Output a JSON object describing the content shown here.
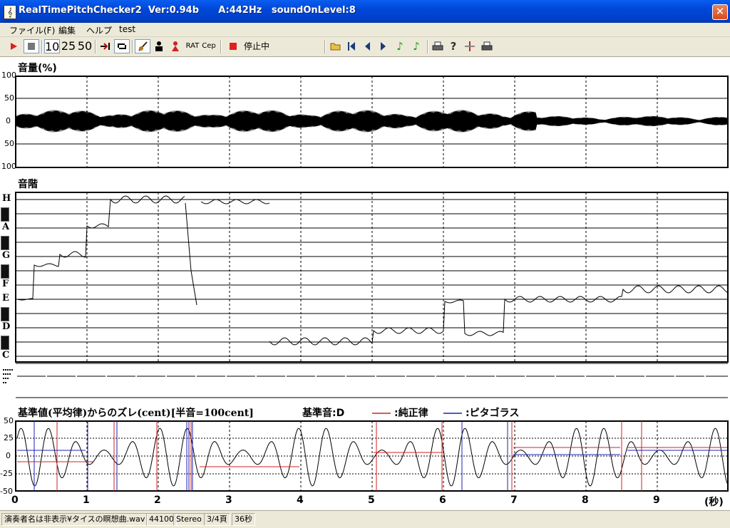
{
  "window": {
    "app_name": "RealTimePitchChecker2",
    "version": "Ver:0.94b",
    "pitch_a": "A:442Hz",
    "sound_on_level": "soundOnLevel:8",
    "icon": "tuning-fork-icon"
  },
  "menu": [
    "ファイル(F)",
    "編集",
    "ヘルプ",
    "test"
  ],
  "toolbar": {
    "speeds": [
      "10",
      "25",
      "50"
    ],
    "ratio_label": "RAT",
    "cep_label": "Cep",
    "stop_state": "停止中",
    "display_value": "＊＊＊",
    "colors": {
      "play": "#e02020",
      "accent_green": "#1a9a1a"
    }
  },
  "volume_panel": {
    "title": "音量(%)",
    "y_ticks": [
      "100",
      "50",
      "0",
      "50",
      "100"
    ]
  },
  "scale_panel": {
    "title": "音階",
    "notes": [
      "H",
      "A",
      "G",
      "F",
      "E",
      "D",
      "C"
    ]
  },
  "deviation_panel": {
    "title": "基準値(平均律)からのズレ(cent)[半音=100cent]",
    "base_note": "基準音:D",
    "legend": [
      {
        "label": ":純正律",
        "color": "#d42020"
      },
      {
        "label": ":ピタゴラス",
        "color": "#2020b0"
      }
    ],
    "y_ticks": [
      "50",
      "25",
      "0",
      "-25",
      "-50"
    ]
  },
  "x_axis": {
    "ticks": [
      "0",
      "1",
      "2",
      "3",
      "4",
      "5",
      "6",
      "7",
      "8",
      "9"
    ],
    "unit": "(秒)"
  },
  "statusbar": {
    "file": "演奏者名は非表示¥タイスの瞑想曲.wav",
    "sample_rate": "44100",
    "channels": "Stereo",
    "page": "3/4頁",
    "duration": "36秒"
  }
}
